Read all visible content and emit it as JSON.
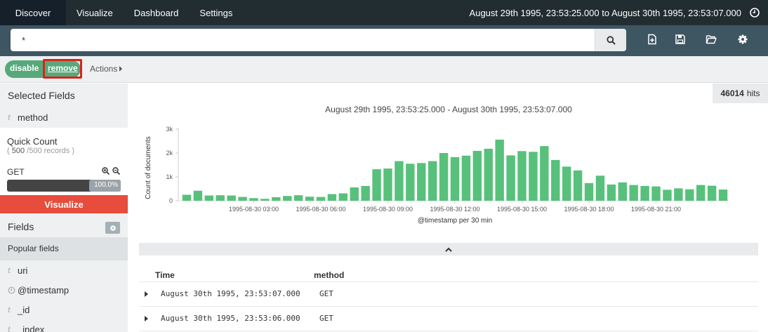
{
  "nav": {
    "tabs": [
      "Discover",
      "Visualize",
      "Dashboard",
      "Settings"
    ],
    "active": "Discover",
    "time_range": "August 29th 1995, 23:53:25.000 to August 30th 1995, 23:53:07.000"
  },
  "search": {
    "query": "*"
  },
  "filter": {
    "disable_label": "disable",
    "remove_label": "remove",
    "actions_label": "Actions"
  },
  "sidebar": {
    "selected_fields_title": "Selected Fields",
    "selected_fields": [
      {
        "name": "method",
        "type": "t"
      }
    ],
    "quick_count": {
      "title": "Quick Count",
      "count": "500",
      "total": "/500 records )",
      "open_paren": "( ",
      "value": "GET",
      "percent_label": "100.0%",
      "percent": 1.0
    },
    "visualize_label": "Visualize",
    "fields_title": "Fields",
    "popular_title": "Popular fields",
    "fields": [
      {
        "name": "uri",
        "type": "t"
      },
      {
        "name": "@timestamp",
        "type": "clock"
      },
      {
        "name": "_id",
        "type": "t"
      },
      {
        "name": "_index",
        "type": "t"
      }
    ]
  },
  "hits": {
    "count": "46014",
    "label": "hits"
  },
  "chart_data": {
    "type": "bar",
    "title": "August 29th 1995, 23:53:25.000 - August 30th 1995, 23:53:07.000",
    "xlabel": "@timestamp per 30 min",
    "ylabel": "Count of documents",
    "ylim": [
      0,
      3000
    ],
    "yticks": [
      "0",
      "1k",
      "2k",
      "3k"
    ],
    "xticks": [
      "1995-08-30 03:00",
      "1995-08-30 06:00",
      "1995-08-30 09:00",
      "1995-08-30 12:00",
      "1995-08-30 15:00",
      "1995-08-30 18:00",
      "1995-08-30 21:00"
    ],
    "color": "#57c17b",
    "values": [
      250,
      420,
      220,
      230,
      220,
      160,
      110,
      80,
      150,
      200,
      230,
      170,
      160,
      280,
      310,
      560,
      620,
      1320,
      1350,
      1660,
      1550,
      1580,
      1660,
      2000,
      1830,
      1890,
      2090,
      2180,
      2560,
      1900,
      2080,
      2050,
      2290,
      1710,
      1430,
      1270,
      740,
      1050,
      680,
      770,
      660,
      620,
      600,
      460,
      520,
      480,
      660,
      630,
      470
    ]
  },
  "table": {
    "headers": [
      "Time",
      "method"
    ],
    "rows": [
      {
        "time": "August 30th 1995, 23:53:07.000",
        "method": "GET"
      },
      {
        "time": "August 30th 1995, 23:53:06.000",
        "method": "GET"
      }
    ]
  }
}
